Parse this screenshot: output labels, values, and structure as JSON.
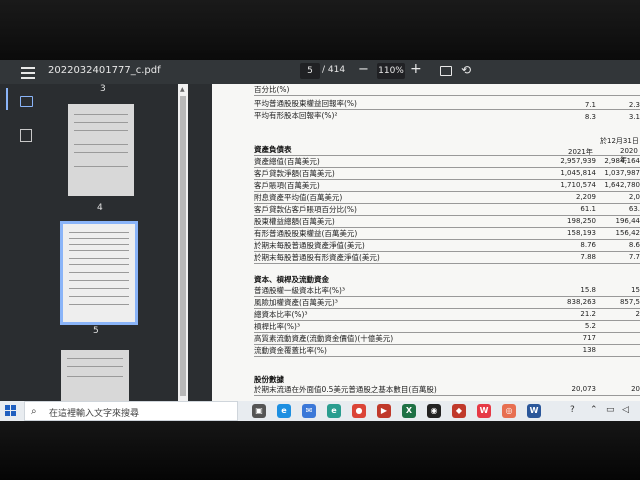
{
  "toolbar": {
    "filename": "2022032401777_c.pdf",
    "current_page": "5",
    "page_total": "/ 414",
    "zoom_minus": "−",
    "zoom": "110%",
    "zoom_plus": "+",
    "rotate_glyph": "⟲"
  },
  "thumbnails": [
    {
      "number": "3"
    },
    {
      "number": "4"
    },
    {
      "number": "5"
    }
  ],
  "document": {
    "top_rows": [
      {
        "label": "百分比(%)",
        "v1": "",
        "v2": ""
      },
      {
        "label": "平均普通股股東權益回報率(%)",
        "v1": "7.1",
        "v2": "2.3"
      },
      {
        "label": "平均有形股本回報率(%)²",
        "v1": "8.3",
        "v2": "3.1"
      }
    ],
    "date_header": "於12月31日",
    "year_2021": "2021年",
    "year_2020": "2020年",
    "balance_title": "資產負債表",
    "balance_rows": [
      {
        "label": "資產總值(百萬美元)",
        "v1": "2,957,939",
        "v2": "2,984,164"
      },
      {
        "label": "客戶貸款淨額(百萬美元)",
        "v1": "1,045,814",
        "v2": "1,037,987"
      },
      {
        "label": "客戶賬項(百萬美元)",
        "v1": "1,710,574",
        "v2": "1,642,780"
      },
      {
        "label": "附息資產平均值(百萬美元)",
        "v1": "2,209",
        "v2": "2,0"
      },
      {
        "label": "客戶貸款佔客戶賬項百分比(%)",
        "v1": "61.1",
        "v2": "63."
      },
      {
        "label": "股東權益總額(百萬美元)",
        "v1": "198,250",
        "v2": "196,44"
      },
      {
        "label": "有形普通股股東權益(百萬美元)",
        "v1": "158,193",
        "v2": "156,42"
      },
      {
        "label": "於期末每股普通股資產淨值(美元)",
        "v1": "8.76",
        "v2": "8.6"
      },
      {
        "label": "於期末每股普通股有形資產淨值(美元)",
        "v1": "7.88",
        "v2": "7.7"
      }
    ],
    "capital_title": "資本、槓桿及流動資金",
    "capital_rows": [
      {
        "label": "普通股權一級資本比率(%)³",
        "v1": "15.8",
        "v2": "15"
      },
      {
        "label": "風險加權資產(百萬美元)³",
        "v1": "838,263",
        "v2": "857,5"
      },
      {
        "label": "總資本比率(%)³",
        "v1": "21.2",
        "v2": "2"
      },
      {
        "label": "槓桿比率(%)³",
        "v1": "5.2",
        "v2": ""
      },
      {
        "label": "高質素流動資產(流動資金價值)(十億美元)",
        "v1": "717",
        "v2": ""
      },
      {
        "label": "流動資金覆蓋比率(%)",
        "v1": "138",
        "v2": ""
      }
    ],
    "share_title": "股份數據",
    "share_rows": [
      {
        "label": "於期末流通在外面值0.5美元普通股之基本數目(百萬股)",
        "v1": "20,073",
        "v2": "20"
      }
    ]
  },
  "taskbar": {
    "search_placeholder": "在這裡輸入文字來搜尋",
    "icons": [
      "task-view-icon",
      "edge-icon",
      "mail-icon",
      "edge-dev-icon",
      "chrome-icon",
      "media-icon",
      "excel-icon",
      "qq-icon",
      "app-icon",
      "weibo-icon",
      "app2-icon",
      "word-icon"
    ],
    "colors": {
      "accent": "#8ab4f8",
      "toolbar": "#323639"
    }
  }
}
